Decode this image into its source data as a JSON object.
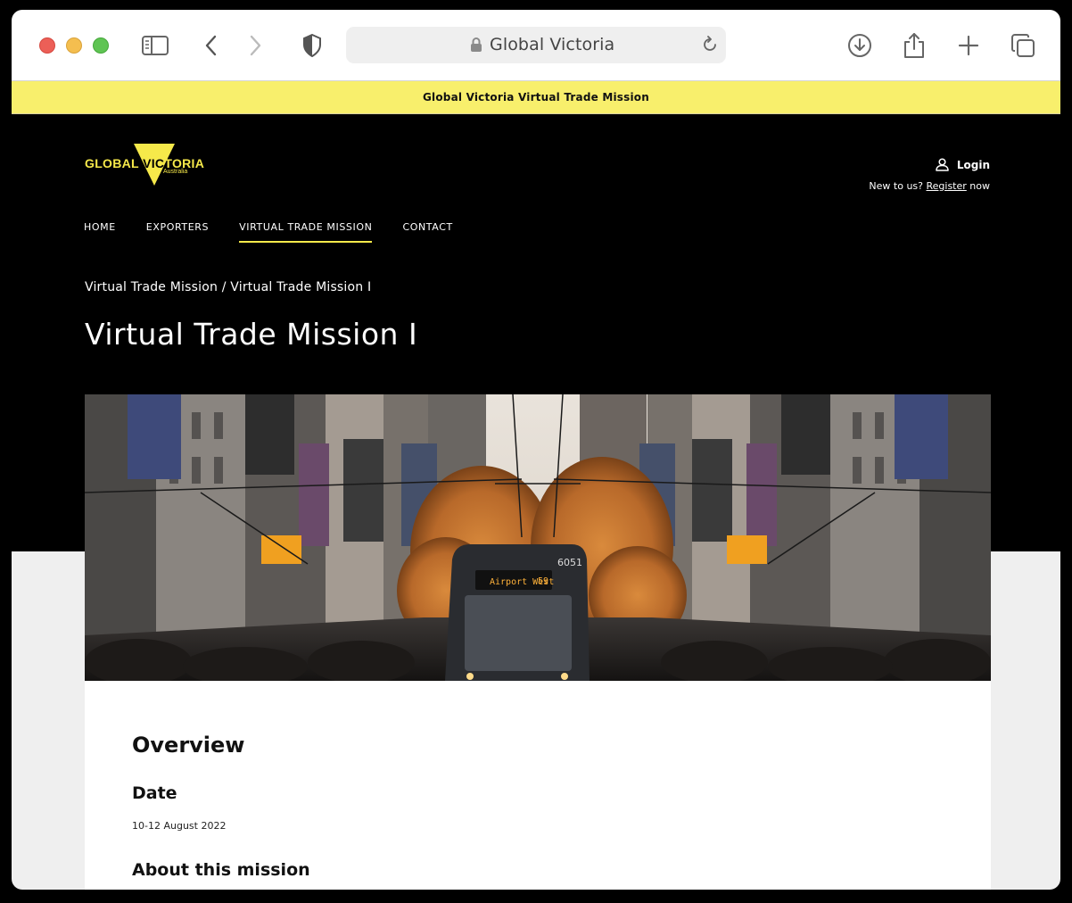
{
  "browser": {
    "address": "Global Victoria",
    "icons": {
      "sidebar": "sidebar-toggle-icon",
      "back": "chevron-left-icon",
      "forward": "chevron-right-icon",
      "privacy": "shield-icon",
      "lock": "lock-icon",
      "reload": "reload-icon",
      "download": "download-icon",
      "share": "share-icon",
      "new_tab": "plus-icon",
      "tabs": "tabs-overview-icon"
    }
  },
  "announcement": "Global Victoria Virtual Trade Mission",
  "site": {
    "logo": {
      "text_left": "GLOBAL",
      "text_right": "TORIA",
      "sub": "Australia"
    },
    "login_label": "Login",
    "register": {
      "prefix": "New to us?",
      "link": "Register",
      "suffix": "now"
    },
    "nav": [
      {
        "label": "HOME"
      },
      {
        "label": "EXPORTERS"
      },
      {
        "label": "VIRTUAL TRADE MISSION"
      },
      {
        "label": "CONTACT"
      }
    ],
    "breadcrumb": {
      "item1": "Virtual Trade Mission",
      "separator": "/",
      "item2": "Virtual Trade Mission I"
    },
    "title": "Virtual Trade Mission I",
    "hero": {
      "tram_number": "6051",
      "tram_destination": "Airport West",
      "tram_route": "59"
    }
  },
  "content": {
    "overview_heading": "Overview",
    "date_heading": "Date",
    "date_value": "10-12 August 2022",
    "about_heading": "About this mission"
  },
  "colors": {
    "brand_yellow": "#f6e94a",
    "announce_bg": "#f8ef6c",
    "site_bg": "#000000",
    "page_lower_bg": "#efefef"
  }
}
